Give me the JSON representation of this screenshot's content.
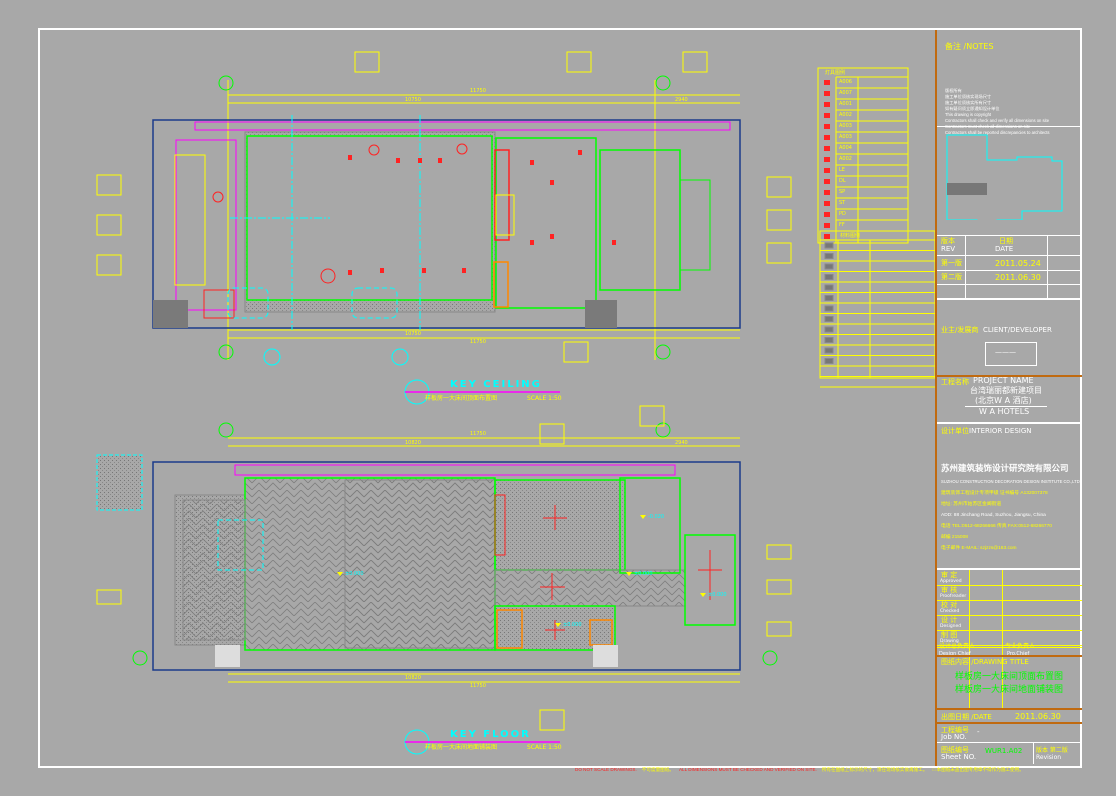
{
  "plans": [
    {
      "title": "KEY CEILING",
      "subtitle": "样板房一大床间顶面布置图",
      "scale": "SCALE 1:50",
      "dims": {
        "overall": "11750",
        "main": "10750",
        "side": "2940"
      }
    },
    {
      "title": "KEY FLOOR",
      "subtitle": "样板房一大床间地面铺装图",
      "scale": "SCALE 1:50",
      "dims": {
        "overall": "11750",
        "main": "10820",
        "side": "2940"
      },
      "levels": [
        "±0.000",
        "±0.000",
        "±0.000",
        "±0.000",
        "-0.020"
      ]
    }
  ],
  "legend_ceiling": {
    "header": "灯具图例",
    "codes": [
      "A006",
      "A007",
      "A001",
      "A002",
      "A003",
      "A003",
      "A004",
      "A002",
      "LE",
      "DL",
      "SP",
      "ST",
      "PD",
      "FF",
      ""
    ]
  },
  "legend_materials": {
    "header": "材料图例",
    "rows": 12
  },
  "title_block": {
    "notes_label": "备注 /NOTES",
    "notes": [
      "版权所有",
      "施工单位须核实现场尺寸",
      "施工单位须核实所有尺寸",
      "如有疑问须立即通知设计单位",
      "This drawing is copyright",
      "Contractors shall check and verify all dimensions on site",
      "Contractors must check all dimensions on site",
      "Contractors shall be reported discrepancies to architects"
    ],
    "rev_label": "版本",
    "rev_label_en": "REV",
    "date_label": "日期",
    "date_label_en": "DATE",
    "revisions": [
      {
        "rev": "第一版",
        "date": "2011.05.24"
      },
      {
        "rev": "第二版",
        "date": "2011.06.30"
      }
    ],
    "client_label": "业主/发展商",
    "client_label_en": "CLIENT/DEVELOPER",
    "client_value": "———",
    "project_label": "工程名称",
    "project_label_en": "PROJECT NAME",
    "project_name": "台湾瑞丽都新建项目",
    "project_sub": "(北京W A 酒店)",
    "project_en": "W A HOTELS",
    "design_label": "设计单位",
    "design_label_en": "INTERIOR DESIGN",
    "company": "苏州建筑装饰设计研究院有限公司",
    "company_en": "SUZHOU CONSTRUCTION DECORATION DESIGN INSTITUTE CO.,LTD",
    "company_lines": [
      "建筑装饰工程设计专项甲级 证书编号 A132007378",
      "地址: 苏州市姑苏区金阊街道",
      "ADD: 88 Jinchang Road, Suzhou, Jiangsu, China",
      "电话 TEL:0512-68266666  传真 FAX:0512-68266770",
      "邮编 215008",
      "电子邮件 E-MAIL: szjzzs@163.com"
    ],
    "signoffs": [
      {
        "cn": "审  定",
        "en": "Approved"
      },
      {
        "cn": "审  核",
        "en": "Proofreader"
      },
      {
        "cn": "校  对",
        "en": "Checked"
      },
      {
        "cn": "设  计",
        "en": "Designed"
      },
      {
        "cn": "制  图",
        "en": "Drawing"
      }
    ],
    "design_chief": "设计总负责人",
    "design_chief_en": "Design Chief",
    "pro_chief": "专业负责人",
    "pro_chief_en": "Pro.Chief",
    "drawing_title_label": "图纸内容 /DRAWING TITLE",
    "drawing_titles": [
      "样板房一大床间顶面布置图",
      "样板房一大床间地面铺装图"
    ],
    "issue_date_label": "出图日期 /DATE",
    "issue_date": "2011.06.30",
    "job_label": "工程编号",
    "job_label_en": "Job NO.",
    "job_value": "-",
    "sheet_label": "图纸编号",
    "sheet_label_en": "Sheet NO.",
    "sheet_value": "WUR1.A02",
    "revision_label": "版本  第二版",
    "revision_label_en": "Revision"
  },
  "footer": {
    "n1": "DO NOT SCALE DRAWINGS.",
    "n2": "不可度量图纸。",
    "n3": "ALL DIMENSIONS MUST BE CHECKED AND VERIFIED ON SITE.",
    "n4": "所有在图纸上标示的尺寸，须在现场核实後再施工。",
    "n5": "□ 本图纸未盖出图专用章不得作为施工使用。"
  },
  "colors": {
    "background": "#a8a8a8",
    "wall": "#00ff00",
    "dimension": "#ffff00",
    "fixture": "#ff0000",
    "axis": "#00ffff",
    "outline": "#ff00ff"
  }
}
